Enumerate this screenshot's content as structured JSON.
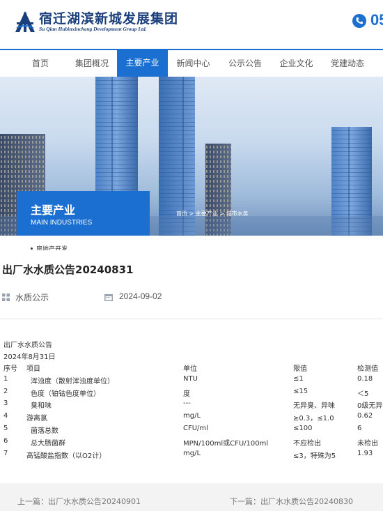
{
  "header": {
    "logo_cn": "宿迁湖滨新城发展集团",
    "logo_en": "Su Qian Hubinxincheng Development Group Ltd.",
    "phone": "05"
  },
  "nav": {
    "items": [
      "首页",
      "集团概况",
      "主要产业",
      "新闻中心",
      "公示公告",
      "企业文化",
      "党建动态"
    ],
    "active_index": 2
  },
  "banner": {
    "section_title": "主要产业",
    "section_subtitle": "MAIN INDUSTRIES",
    "breadcrumb": [
      "首页",
      "主要产业",
      "城市水务"
    ],
    "breadcrumb_sep": " > ",
    "side_menu_item": "房地产开发"
  },
  "article": {
    "title": "出厂水水质公告20240831",
    "category": "水质公示",
    "date": "2024-09-02",
    "heading": "出厂水水质公告",
    "report_date": "2024年8月31日",
    "table": {
      "headers": [
        "序号",
        "项目",
        "单位",
        "限值",
        "检测值"
      ],
      "rows": [
        [
          "1",
          "浑浊度（散射浑浊度单位）",
          "NTU",
          "≤1",
          "0.18"
        ],
        [
          "2",
          "色度（铂钴色度单位）",
          "度",
          "≤15",
          "＜5"
        ],
        [
          "3",
          "臭和味",
          "---",
          "无异臭、异味",
          "0级无异"
        ],
        [
          "4",
          "游离氯",
          "mg/L",
          "≥0.3，≤1.0",
          "0.62"
        ],
        [
          "5",
          "菌落总数",
          "CFU/ml",
          "≤100",
          "6"
        ],
        [
          "6",
          "总大肠菌群",
          "MPN/100ml或CFU/100ml",
          "不应检出",
          "未检出"
        ],
        [
          "7",
          "高锰酸盐指数（以O2计）",
          "mg/L",
          "≤3，特殊为5",
          "1.93"
        ]
      ]
    }
  },
  "pager": {
    "prev": "上一篇：出厂水水质公告20240901",
    "next": "下一篇：出厂水水质公告20240830"
  },
  "colors": {
    "accent": "#1a6fd1",
    "brand": "#1b3f7a"
  }
}
